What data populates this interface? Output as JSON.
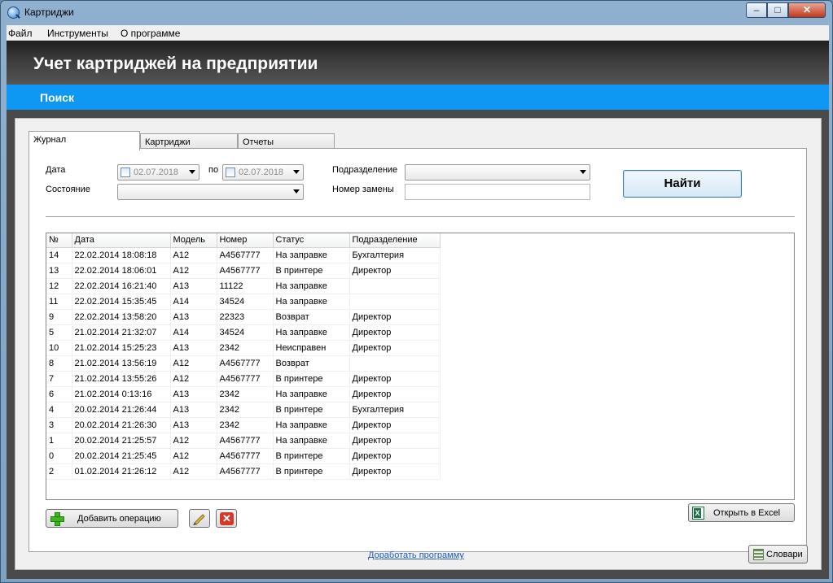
{
  "window": {
    "title": "Картриджи"
  },
  "menu": [
    "Файл",
    "Инструменты",
    "О программе"
  ],
  "header": {
    "title": "Учет картриджей на предприятии",
    "subtitle": "Поиск"
  },
  "tabs": [
    "Журнал",
    "Картриджи",
    "Отчеты"
  ],
  "filters": {
    "date_label": "Дата",
    "date_from": "02.07.2018",
    "to_label": "по",
    "date_to": "02.07.2018",
    "state_label": "Состояние",
    "state_value": "",
    "department_label": "Подразделение",
    "department_value": "",
    "replacement_label": "Номер замены",
    "replacement_value": "",
    "find_button": "Найти"
  },
  "table": {
    "columns": [
      "№",
      "Дата",
      "Модель",
      "Номер",
      "Статус",
      "Подразделение"
    ],
    "rows": [
      [
        "14",
        "22.02.2014 18:08:18",
        "A12",
        "A4567777",
        "На заправке",
        "Бухгалтерия"
      ],
      [
        "13",
        "22.02.2014 18:06:01",
        "A12",
        "A4567777",
        "В принтере",
        "Директор"
      ],
      [
        "12",
        "22.02.2014 16:21:40",
        "A13",
        "11122",
        "На заправке",
        ""
      ],
      [
        "11",
        "22.02.2014 15:35:45",
        "A14",
        "34524",
        "На заправке",
        ""
      ],
      [
        "9",
        "22.02.2014 13:58:20",
        "A13",
        "22323",
        "Возврат",
        "Директор"
      ],
      [
        "5",
        "21.02.2014 21:32:07",
        "A14",
        "34524",
        "На заправке",
        "Директор"
      ],
      [
        "10",
        "21.02.2014 15:25:23",
        "A13",
        "2342",
        "Неисправен",
        "Директор"
      ],
      [
        "8",
        "21.02.2014 13:56:19",
        "A12",
        "A4567777",
        "Возврат",
        ""
      ],
      [
        "7",
        "21.02.2014 13:55:26",
        "A12",
        "A4567777",
        "В принтере",
        "Директор"
      ],
      [
        "6",
        "21.02.2014 0:13:16",
        "A13",
        "2342",
        "На заправке",
        "Директор"
      ],
      [
        "4",
        "20.02.2014 21:26:44",
        "A13",
        "2342",
        "В принтере",
        "Бухгалтерия"
      ],
      [
        "3",
        "20.02.2014 21:26:30",
        "A13",
        "2342",
        "На заправке",
        "Директор"
      ],
      [
        "1",
        "20.02.2014 21:25:57",
        "A12",
        "A4567777",
        "На заправке",
        "Директор"
      ],
      [
        "0",
        "20.02.2014 21:25:45",
        "A12",
        "A4567777",
        "В принтере",
        "Директор"
      ],
      [
        "2",
        "01.02.2014 21:26:12",
        "A12",
        "A4567777",
        "В принтере",
        "Директор"
      ]
    ]
  },
  "buttons": {
    "add_operation": "Добавить операцию",
    "open_excel": "Открыть в Excel",
    "dictionaries": "Словари"
  },
  "footer_link": "Доработать программу",
  "icons": {
    "add": "plus-icon",
    "edit": "pencil-icon",
    "delete": "delete-icon",
    "excel": "excel-icon",
    "dictionaries": "book-icon"
  },
  "colors": {
    "accent_blue": "#0f98f3",
    "header_dark": "#2e2e2e"
  }
}
